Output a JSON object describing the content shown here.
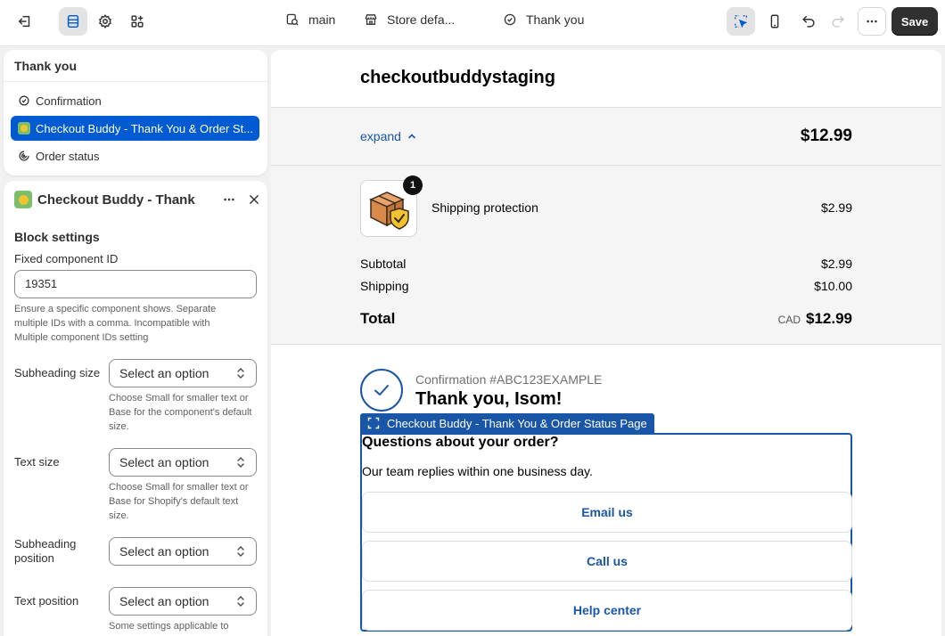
{
  "topbar": {
    "exit_icon": "exit-icon",
    "sections_icon": "sections-icon",
    "settings_icon": "gear-icon",
    "apps_icon": "apps-icon",
    "theme_label": "main",
    "store_label": "Store defa...",
    "page_label": "Thank you",
    "inspector_icon": "inspector-icon",
    "mobile_icon": "mobile-icon",
    "undo_icon": "undo-icon",
    "redo_icon": "redo-icon",
    "more_icon": "more-icon",
    "save_label": "Save"
  },
  "sections_panel": {
    "title": "Thank you",
    "items": [
      {
        "label": "Confirmation",
        "icon": "check-circle-icon"
      },
      {
        "label": "Checkout Buddy - Thank You & Order St...",
        "icon": "app-icon",
        "selected": true
      },
      {
        "label": "Order status",
        "icon": "order-status-icon"
      }
    ]
  },
  "block_panel": {
    "title": "Checkout Buddy - Thank Y",
    "section_heading": "Block settings",
    "component_id_label": "Fixed component ID",
    "component_id_value": "19351",
    "component_id_help": "Ensure a specific component shows. Separate multiple IDs with a comma. Incompatible with Multiple component IDs setting",
    "subheading_size_label": "Subheading size",
    "subheading_size_value": "Select an option",
    "subheading_size_help": "Choose Small for smaller text or Base for the component's default size.",
    "text_size_label": "Text size",
    "text_size_value": "Select an option",
    "text_size_help": "Choose Small for smaller text or Base for Shopify's default text size.",
    "subheading_position_label": "Subheading position",
    "subheading_position_value": "Select an option",
    "text_position_label": "Text position",
    "text_position_value": "Select an option",
    "text_position_help": "Some settings applicable to"
  },
  "preview": {
    "shop_name": "checkoutbuddystaging",
    "expand_label": "expand",
    "band_total": "$12.99",
    "line_item": {
      "title": "Shipping protection",
      "price": "$2.99",
      "quantity": "1"
    },
    "subtotal_label": "Subtotal",
    "subtotal_value": "$2.99",
    "shipping_label": "Shipping",
    "shipping_value": "$10.00",
    "total_label": "Total",
    "total_currency": "CAD",
    "total_value": "$12.99",
    "confirmation_number": "Confirmation #ABC123EXAMPLE",
    "thank_you": "Thank you, Isom!",
    "block_label": "Checkout Buddy - Thank You & Order Status Page",
    "question_heading": "Questions about your order?",
    "question_sub": "Our team replies within one business day.",
    "buttons": [
      {
        "label": "Email us"
      },
      {
        "label": "Call us"
      },
      {
        "label": "Help center"
      }
    ]
  },
  "colors": {
    "accent": "#005bd3",
    "link": "#1a56a8",
    "save_bg": "#303030"
  }
}
